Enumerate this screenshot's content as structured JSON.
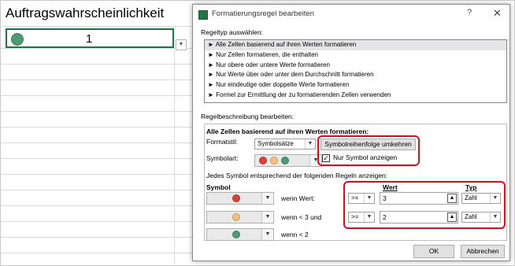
{
  "excel": {
    "title": "Auftragswahrscheinlichkeit",
    "cell_value": "1"
  },
  "dialog": {
    "title": "Formatierungsregel bearbeiten",
    "help": "?",
    "close": "✕",
    "rule_type_label": "Regeltyp auswählen:",
    "rule_types": [
      "► Alle Zellen basierend auf ihren Werten formatieren",
      "► Nur Zellen formatieren, die enthalten",
      "► Nur obere oder untere Werte formatieren",
      "► Nur Werte über oder unter dem Durchschnitt formatieren",
      "► Nur eindeutige oder doppelte Werte formatieren",
      "► Formel zur Ermittlung der zu formatierenden Zellen verwenden"
    ],
    "rule_desc_label": "Regelbeschreibung bearbeiten:",
    "desc_heading": "Alle Zellen basierend auf ihren Werten formatieren:",
    "format_style_label": "Formatstil:",
    "format_style_value": "Symbolsätze",
    "icon_style_label": "Symbolart:",
    "reverse_button": "Symbolreihenfolge umkehren",
    "show_icon_only": "Nur Symbol anzeigen",
    "show_icon_only_checked": "✓",
    "rules_heading": "Jedes Symbol entsprechend der folgenden Regeln anzeigen:",
    "col_symbol": "Symbol",
    "col_wert": "Wert",
    "col_typ": "Typ",
    "rows": [
      {
        "cond": "wenn Wert:",
        "op": ">=",
        "value": "3",
        "type": "Zahl"
      },
      {
        "cond": "wenn < 3 und",
        "op": ">=",
        "value": "2",
        "type": "Zahl"
      },
      {
        "cond": "wenn < 2"
      }
    ],
    "ok": "OK",
    "cancel": "Abbrechen"
  },
  "colors": {
    "highlight": "#d90b1e",
    "red_icon": "#d9443a",
    "yellow_icon": "#f2c080",
    "green_icon": "#4e9a75",
    "excel_green": "#217346"
  },
  "icons": [
    "dropdown-arrow-icon",
    "spin-icon",
    "red-circle-icon",
    "yellow-circle-icon",
    "green-circle-icon"
  ]
}
